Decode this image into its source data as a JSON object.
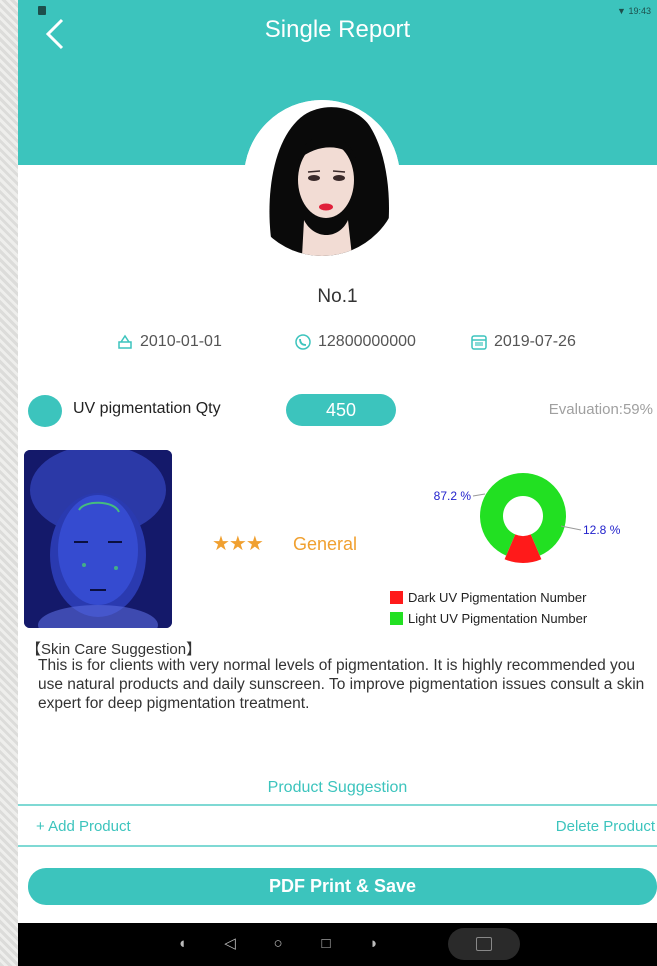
{
  "header": {
    "title": "Single Report",
    "status_time": "19:43"
  },
  "profile": {
    "name": "No.1",
    "birthdate": "2010-01-01",
    "phone": "12800000000",
    "report_date": "2019-07-26"
  },
  "uv": {
    "label": "UV pigmentation Qty",
    "value": "450",
    "evaluation": "Evaluation:59%"
  },
  "rating": {
    "stars": "★★★",
    "label": "General"
  },
  "chart_data": {
    "type": "pie",
    "values": [
      12.8,
      87.2
    ],
    "categories": [
      "Dark UV Pigmentation Number",
      "Light UV Pigmentation Number"
    ],
    "labels": [
      "12.8 %",
      "87.2 %"
    ],
    "colors": [
      "#ff1a1a",
      "#22e022"
    ],
    "legend": "bottom-right"
  },
  "suggestion": {
    "title": "【Skin Care Suggestion】",
    "body": "This is for clients with very normal levels of pigmentation. It is highly recommended you use natural products and daily sunscreen. To improve pigmentation issues consult a skin expert for deep pigmentation treatment."
  },
  "products": {
    "title": "Product Suggestion",
    "add": "+ Add Product",
    "delete": "Delete Product"
  },
  "actions": {
    "pdf": "PDF Print & Save"
  },
  "colors": {
    "accent": "#3cc4bd",
    "star": "#f0a030"
  }
}
